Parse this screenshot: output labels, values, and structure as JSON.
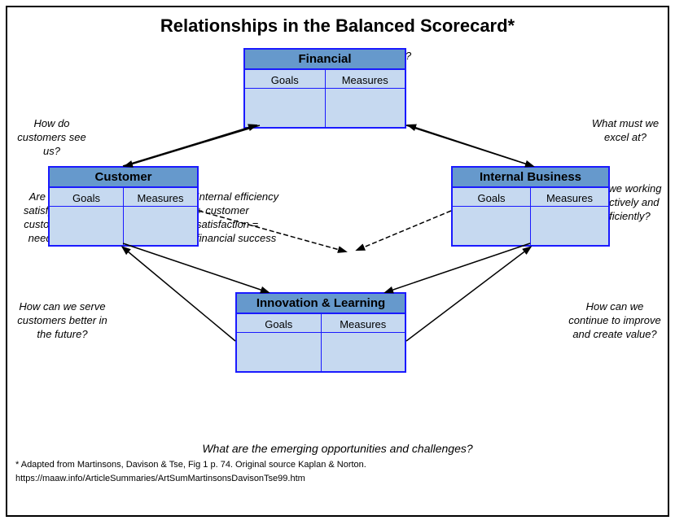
{
  "title": "Relationships in the Balanced Scorecard*",
  "subtitle_top": "How do we look to shareholders?",
  "label_customers_see": "How do customers see us?",
  "label_excel": "What must we excel at?",
  "label_satisfying": "Are we satisfying customer needs?",
  "label_working": "Are we working effectively and efficiently?",
  "label_center_line1": "Internal efficiency",
  "label_center_line2": "+ customer",
  "label_center_line3": "satisfaction =",
  "label_center_line4": "financial success",
  "label_serve": "How can we serve customers better in the future?",
  "label_continue": "How can we continue to improve and create value?",
  "label_bottom": "What are the emerging opportunities and challenges?",
  "footnote_line1": "* Adapted from Martinsons, Davison & Tse, Fig 1  p. 74.  Original source Kaplan & Norton.",
  "footnote_line2": "https://maaw.info/ArticleSummaries/ArtSumMartinsonsDavisonTse99.htm",
  "boxes": {
    "financial": {
      "title": "Financial",
      "col1": "Goals",
      "col2": "Measures"
    },
    "customer": {
      "title": "Customer",
      "col1": "Goals",
      "col2": "Measures"
    },
    "internal": {
      "title": "Internal Business",
      "col1": "Goals",
      "col2": "Measures"
    },
    "innovation": {
      "title": "Innovation & Learning",
      "col1": "Goals",
      "col2": "Measures"
    }
  }
}
